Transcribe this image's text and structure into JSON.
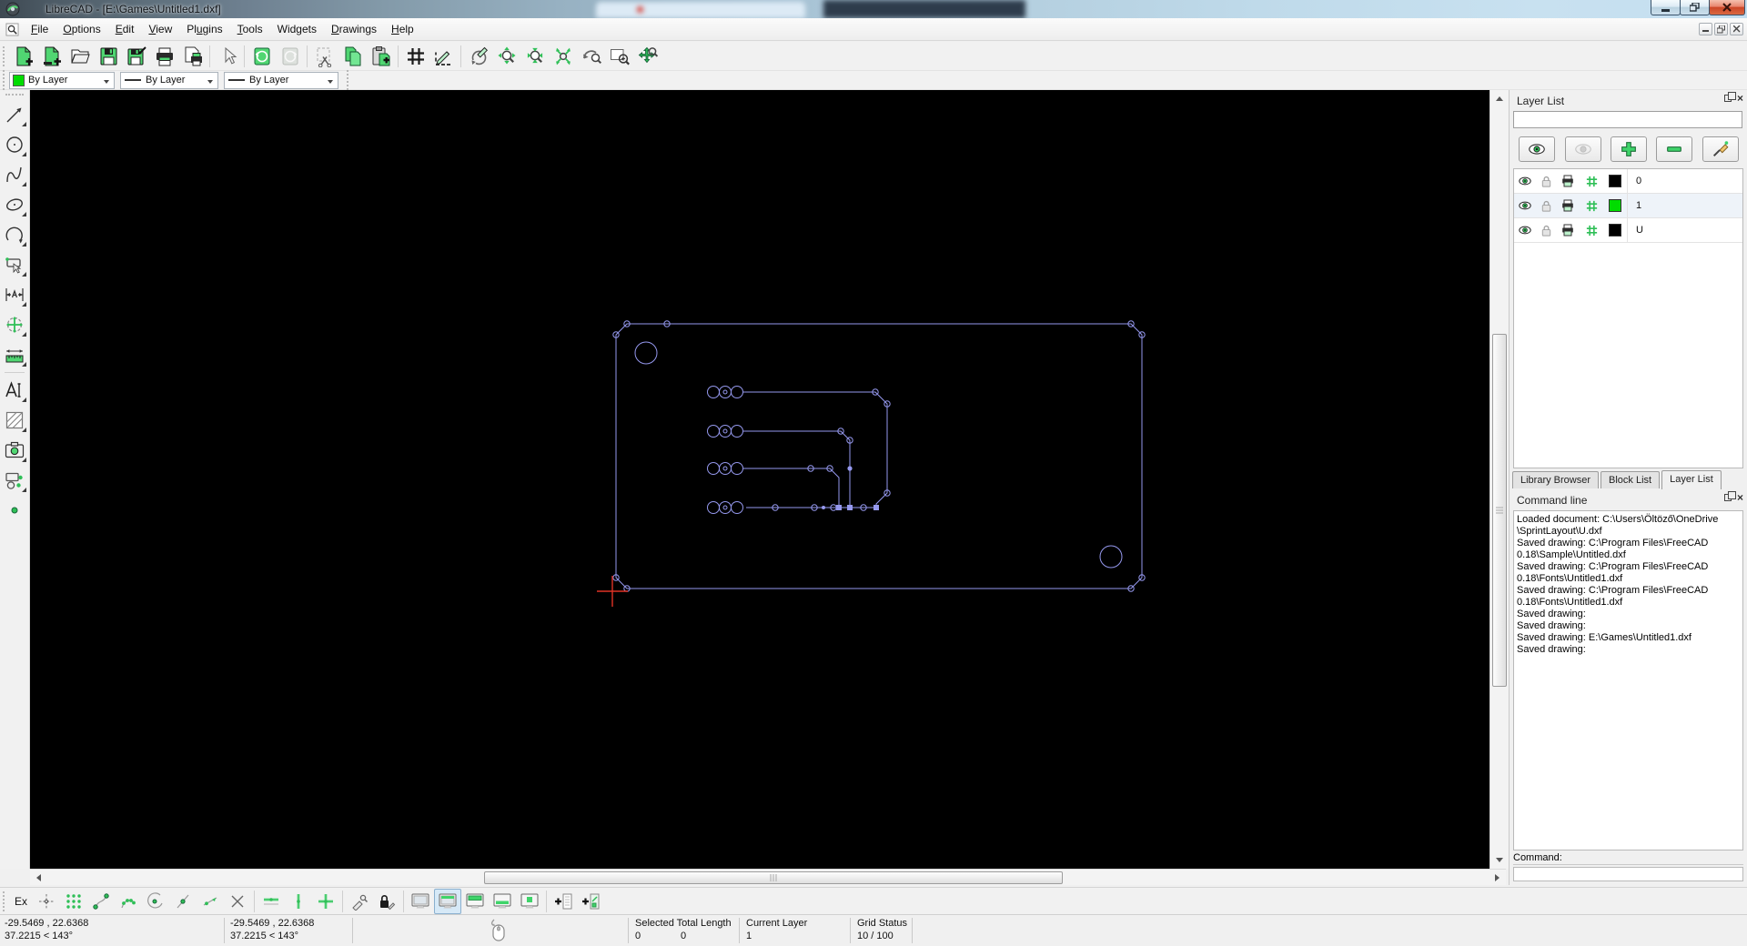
{
  "window": {
    "title": "LibreCAD - [E:\\Games\\Untitled1.dxf]"
  },
  "menu": {
    "items": [
      {
        "pre": "",
        "u": "F",
        "post": "ile"
      },
      {
        "pre": "",
        "u": "O",
        "post": "ptions"
      },
      {
        "pre": "",
        "u": "E",
        "post": "dit"
      },
      {
        "pre": "",
        "u": "V",
        "post": "iew"
      },
      {
        "pre": "Pl",
        "u": "u",
        "post": "gins"
      },
      {
        "pre": "",
        "u": "T",
        "post": "ools"
      },
      {
        "pre": "Widgets",
        "u": "",
        "post": ""
      },
      {
        "pre": "",
        "u": "D",
        "post": "rawings"
      },
      {
        "pre": "",
        "u": "H",
        "post": "elp"
      }
    ]
  },
  "pen_bar": {
    "color_label": "By Layer",
    "color_swatch": "#00dc00",
    "width_label": "By Layer",
    "linetype_label": "By Layer"
  },
  "layer_list": {
    "title": "Layer List",
    "layers": [
      {
        "name": "0",
        "color": "#000000"
      },
      {
        "name": "1",
        "color": "#00dc00"
      },
      {
        "name": "U",
        "color": "#000000"
      }
    ]
  },
  "dock_tabs": {
    "library": "Library Browser",
    "block": "Block List",
    "layer": "Layer List"
  },
  "command_line": {
    "title": "Command line",
    "prompt": "Command:",
    "lines": [
      "Loaded document: C:\\Users\\Öltöző\\OneDrive",
      "\\SprintLayout\\U.dxf",
      "Saved drawing: C:\\Program Files\\FreeCAD",
      "0.18\\Sample\\Untitled.dxf",
      "Saved drawing: C:\\Program Files\\FreeCAD",
      "0.18\\Fonts\\Untitled1.dxf",
      "Saved drawing: C:\\Program Files\\FreeCAD",
      "0.18\\Fonts\\Untitled1.dxf",
      "Saved drawing:",
      "Saved drawing:",
      "Saved drawing: E:\\Games\\Untitled1.dxf",
      "Saved drawing:"
    ]
  },
  "snap_bar": {
    "ex": "Ex"
  },
  "status_bar": {
    "abs_coord": "-29.5469 , 22.6368",
    "abs_polar": "37.2215 < 143°",
    "rel_coord": "-29.5469 , 22.6368",
    "rel_polar": "37.2215 < 143°",
    "selected_label": "Selected",
    "total_label": "Total Length",
    "selected_value": "0",
    "total_value": "0",
    "layer_label": "Current Layer",
    "layer_value": "1",
    "grid_label": "Grid Status",
    "grid_value": "10 / 100"
  },
  "drawing": {
    "stroke": "#9598ee",
    "marker_color": "#e03226"
  }
}
